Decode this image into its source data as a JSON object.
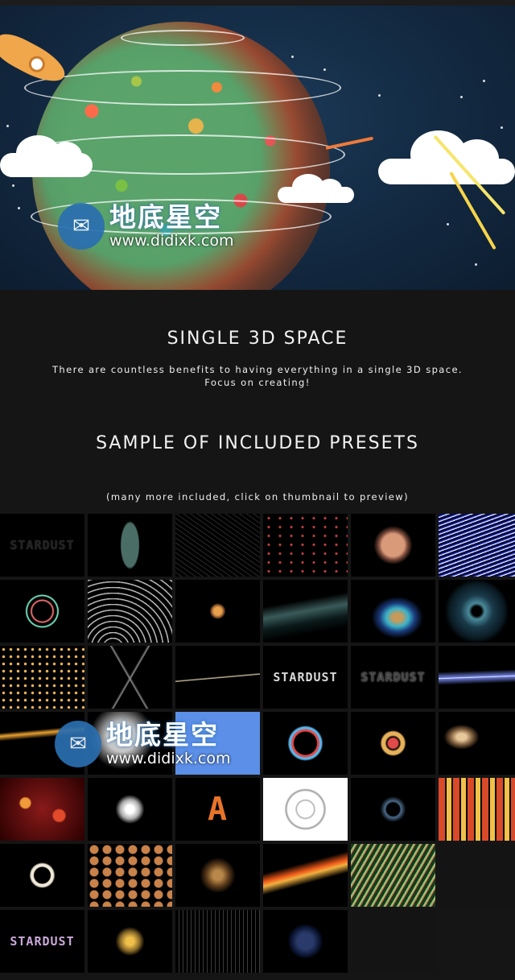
{
  "hero": {
    "watermark": {
      "name": "地底星空",
      "url": "www.didixk.com"
    }
  },
  "feature": {
    "title": "SINGLE 3D SPACE",
    "description_line1": "There are countless benefits to having everything in a single 3D space.",
    "description_line2": "Focus on creating!"
  },
  "presets": {
    "title": "SAMPLE OF INCLUDED PRESETS",
    "note": "(many more included, click on thumbnail to preview)",
    "thumbnails": [
      {
        "label": "STARDUST",
        "style": "dark-text"
      },
      {
        "label": "",
        "style": "column"
      },
      {
        "label": "",
        "style": "scratch"
      },
      {
        "label": "",
        "style": "dots"
      },
      {
        "label": "",
        "style": "cluster"
      },
      {
        "label": "",
        "style": "blue-lines"
      },
      {
        "label": "",
        "style": "rings"
      },
      {
        "label": "",
        "style": "white-waves"
      },
      {
        "label": "",
        "style": "orange-dot"
      },
      {
        "label": "",
        "style": "wave-mesh"
      },
      {
        "label": "",
        "style": "swirl"
      },
      {
        "label": "",
        "style": "tunnel"
      },
      {
        "label": "",
        "style": "gold-spiral"
      },
      {
        "label": "",
        "style": "triangle"
      },
      {
        "label": "",
        "style": "streak"
      },
      {
        "label": "STARDUST",
        "style": "silver-text"
      },
      {
        "label": "STARDUST",
        "style": "mirror-text"
      },
      {
        "label": "",
        "style": "blue-streak"
      },
      {
        "label": "",
        "style": "gold-arc"
      },
      {
        "label": "",
        "style": "grey-splash"
      },
      {
        "label": "",
        "style": "sky"
      },
      {
        "label": "",
        "style": "red-blue-ring"
      },
      {
        "label": "",
        "style": "sunflower"
      },
      {
        "label": "",
        "style": "comet"
      },
      {
        "label": "",
        "style": "bokeh"
      },
      {
        "label": "",
        "style": "pinwheel"
      },
      {
        "label": "A",
        "style": "letter-a"
      },
      {
        "label": "",
        "style": "white-panel"
      },
      {
        "label": "",
        "style": "faint-ring"
      },
      {
        "label": "",
        "style": "tiles"
      },
      {
        "label": "",
        "style": "dot-ring"
      },
      {
        "label": "",
        "style": "hexes"
      },
      {
        "label": "",
        "style": "spark-cloud"
      },
      {
        "label": "",
        "style": "fire-arc"
      },
      {
        "label": "",
        "style": "green-stripes"
      },
      {
        "label": "",
        "style": "empty"
      },
      {
        "label": "STARDUST",
        "style": "color-text"
      },
      {
        "label": "",
        "style": "burst"
      },
      {
        "label": "",
        "style": "lines-field"
      },
      {
        "label": "",
        "style": "blue-orb"
      },
      {
        "label": "",
        "style": "empty"
      }
    ]
  },
  "colors": {
    "background": "#151515",
    "hero_sky": "#142c45",
    "watermark_blue": "#2a6fb0"
  }
}
